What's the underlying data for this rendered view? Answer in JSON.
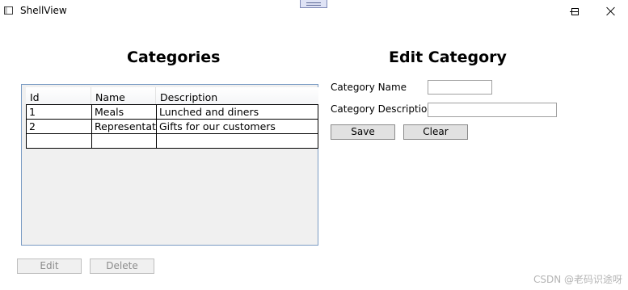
{
  "window": {
    "title": "ShellView"
  },
  "categories_heading": "Categories",
  "edit_heading": "Edit Category",
  "grid": {
    "columns": [
      "Id",
      "Name",
      "Description"
    ],
    "rows": [
      {
        "id": "1",
        "name": "Meals",
        "description": "Lunched and diners"
      },
      {
        "id": "2",
        "name": "Representati",
        "description": "Gifts for our customers"
      },
      {
        "id": "",
        "name": "",
        "description": ""
      }
    ]
  },
  "form": {
    "name_label": "Category Name",
    "name_value": "",
    "description_label": "Category Description",
    "description_value": "",
    "save_label": "Save",
    "clear_label": "Clear"
  },
  "actions": {
    "edit_label": "Edit",
    "delete_label": "Delete"
  },
  "watermark": "CSDN @老码识途呀",
  "colors": {
    "grid_border": "#7a9bc3",
    "button_face": "#e1e1e1",
    "disabled_text": "#8c8c8c"
  }
}
